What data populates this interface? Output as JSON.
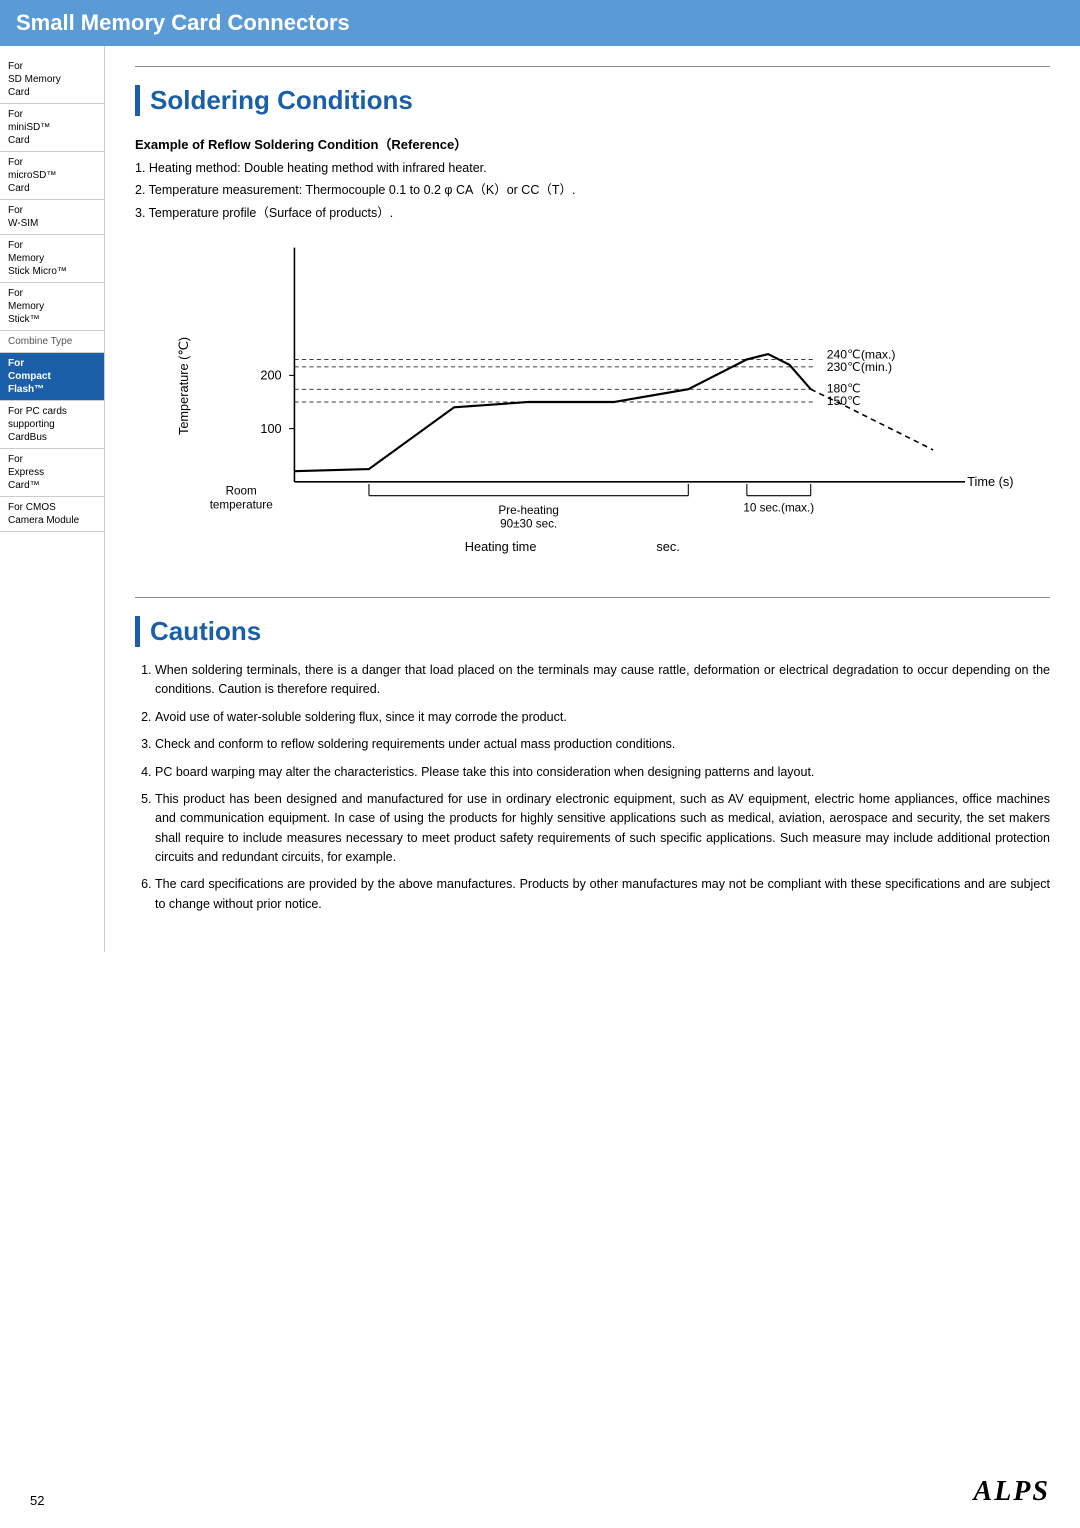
{
  "header": {
    "title": "Small Memory Card Connectors"
  },
  "sidebar": {
    "items": [
      {
        "id": "sd-memory-card",
        "label": "For\nSD Memory\nCard",
        "active": false
      },
      {
        "id": "mini-sd-card",
        "label": "For\nminiSD™\nCard",
        "active": false
      },
      {
        "id": "micro-sd-card",
        "label": "For\nmicroSD™\nCard",
        "active": false
      },
      {
        "id": "w-sim",
        "label": "For\nW-SIM",
        "active": false
      },
      {
        "id": "memory-stick-micro",
        "label": "For\nMemory\nStick Micro™",
        "active": false
      },
      {
        "id": "memory-stick",
        "label": "For\nMemory\nStick™",
        "active": false
      },
      {
        "id": "combine-type",
        "label": "Combine Type",
        "active": false,
        "combineType": true
      },
      {
        "id": "compact-flash",
        "label": "For\nCompact\nFlash™",
        "active": true
      },
      {
        "id": "pc-cards-cardbus",
        "label": "For PC cards\nsupporting\nCardBus",
        "active": false
      },
      {
        "id": "express-card",
        "label": "For\nExpress\nCard™",
        "active": false
      },
      {
        "id": "cmos-camera-module",
        "label": "For CMOS\nCamera Module",
        "active": false
      }
    ]
  },
  "soldering": {
    "section_title": "Soldering Conditions",
    "example_heading": "Example of Reflow Soldering Condition（Reference）",
    "list_items": [
      "1. Heating method: Double heating method with infrared heater.",
      "2. Temperature measurement: Thermocouple 0.1 to 0.2 φ  CA（K）or CC（T）.",
      "3. Temperature profile（Surface of products）."
    ],
    "chart": {
      "y_label": "Temperature (℃)",
      "x_label": "Time (s)",
      "y_values": [
        "200",
        "100"
      ],
      "room_temp_label": "Room\ntemperature",
      "preheating_label": "Pre-heating\n90±30 sec.",
      "heating_time_label": "Heating time",
      "sec_label": "sec.",
      "ten_sec_label": "10 sec.(max.)",
      "temp_240": "240℃(max.)",
      "temp_230": "230℃(min.)",
      "temp_180": "180℃",
      "temp_150": "150℃"
    }
  },
  "cautions": {
    "section_title": "Cautions",
    "items": [
      "When soldering terminals, there is a danger that load placed on the terminals may cause rattle, deformation or electrical degradation to occur depending on the conditions. Caution is therefore required.",
      "Avoid use of water-soluble soldering flux, since it may corrode the product.",
      "Check and conform to reflow soldering requirements under actual mass production conditions.",
      "PC board warping may alter the characteristics. Please take this into consideration when designing patterns and layout.",
      "This product has been designed and manufactured for use in ordinary electronic equipment, such as AV equipment, electric home appliances, office machines and communication equipment.  In case of using the products for highly sensitive applications such as medical, aviation, aerospace and security, the set makers shall require to include measures necessary to meet product safety requirements of such specific applications. Such measure may include additional protection circuits and redundant circuits, for example.",
      "The card specifications are provided by the above manufactures. Products by other manufactures may not be compliant with these specifications and are subject to change without prior notice."
    ]
  },
  "footer": {
    "page_number": "52",
    "brand": "ALPS"
  }
}
